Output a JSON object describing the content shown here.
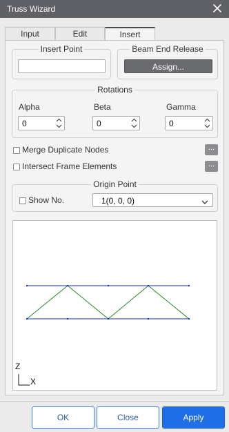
{
  "window": {
    "title": "Truss Wizard"
  },
  "tabs": [
    {
      "label": "Input"
    },
    {
      "label": "Edit"
    },
    {
      "label": "Insert"
    }
  ],
  "insert_point": {
    "title": "Insert Point",
    "value": ""
  },
  "beam_end_release": {
    "title": "Beam End Release",
    "button_label": "Assign..."
  },
  "rotations": {
    "title": "Rotations",
    "alpha": {
      "label": "Alpha",
      "value": "0"
    },
    "beta": {
      "label": "Beta",
      "value": "0"
    },
    "gamma": {
      "label": "Gamma",
      "value": "0"
    }
  },
  "options": {
    "merge_duplicate_nodes": {
      "label": "Merge Duplicate Nodes",
      "checked": false,
      "button_label": "..."
    },
    "intersect_frame_elements": {
      "label": "Intersect Frame Elements",
      "checked": false,
      "button_label": "..."
    }
  },
  "origin_point": {
    "title": "Origin Point",
    "show_no": {
      "label": "Show No.",
      "checked": false
    },
    "selected": "1(0, 0, 0)"
  },
  "preview": {
    "axis_z": "Z",
    "axis_x": "X",
    "chord_color": "#1a2fd1",
    "web_color": "#1f8a1f"
  },
  "footer": {
    "ok_label": "OK",
    "close_label": "Close",
    "apply_label": "Apply"
  }
}
